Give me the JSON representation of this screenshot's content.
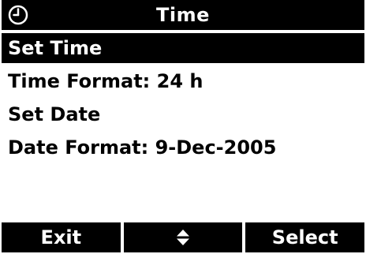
{
  "title_bar": {
    "icon": "clock-icon",
    "title": "Time"
  },
  "menu": {
    "items": [
      {
        "label": "Set Time",
        "selected": true
      },
      {
        "label": "Time Format: 24 h",
        "selected": false
      },
      {
        "label": "Set Date",
        "selected": false
      },
      {
        "label": "Date Format: 9-Dec-2005",
        "selected": false
      }
    ]
  },
  "softkeys": {
    "left_label": "Exit",
    "center_icon": "up-down-arrows-icon",
    "right_label": "Select"
  },
  "colors": {
    "background": "#ffffff",
    "foreground": "#000000",
    "highlight": "#000000",
    "highlight_text": "#ffffff"
  }
}
